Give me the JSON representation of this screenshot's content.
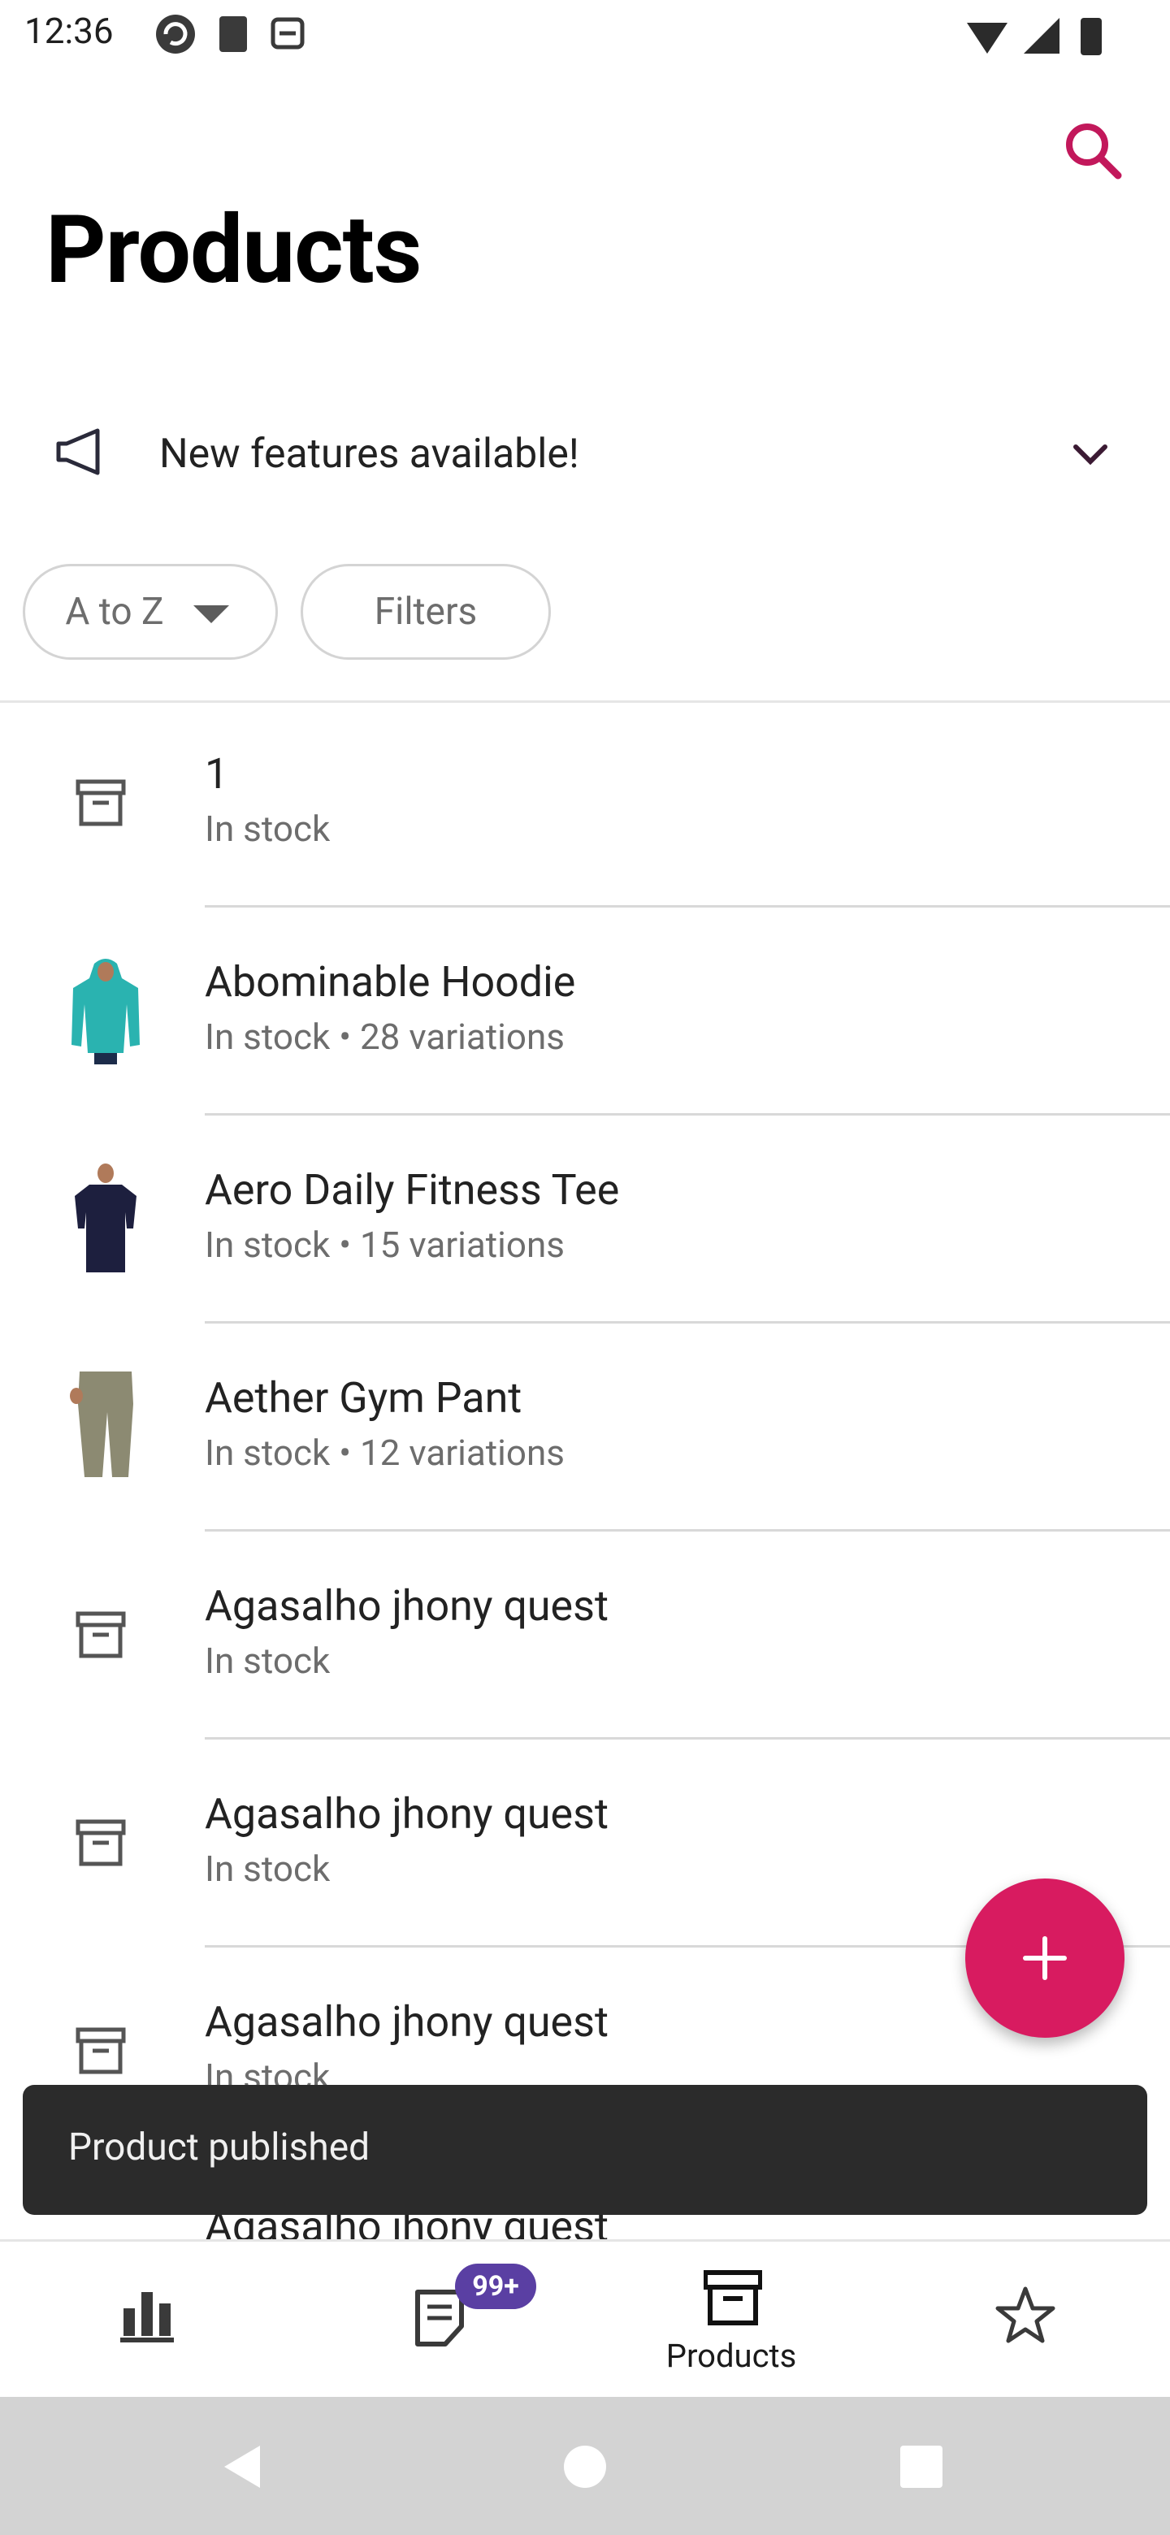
{
  "status_bar": {
    "time": "12:36"
  },
  "header": {
    "title": "Products"
  },
  "banner": {
    "text": "New features available!"
  },
  "filters": {
    "sort_label": "A to Z",
    "filters_label": "Filters"
  },
  "products": [
    {
      "title": "1",
      "subtitle": "In stock",
      "image": "archive-icon"
    },
    {
      "title": "Abominable Hoodie",
      "subtitle": "In stock • 28 variations",
      "image": "hoodie-thumbnail"
    },
    {
      "title": "Aero Daily Fitness Tee",
      "subtitle": "In stock • 15 variations",
      "image": "tee-thumbnail"
    },
    {
      "title": "Aether Gym Pant",
      "subtitle": "In stock • 12 variations",
      "image": "pant-thumbnail"
    },
    {
      "title": "Agasalho jhony quest",
      "subtitle": "In stock",
      "image": "archive-icon"
    },
    {
      "title": "Agasalho jhony quest",
      "subtitle": "In stock",
      "image": "archive-icon"
    },
    {
      "title": "Agasalho jhony quest",
      "subtitle": "In stock",
      "image": "archive-icon"
    },
    {
      "title": "Agasalho jhony quest",
      "subtitle": "",
      "image": "archive-icon"
    }
  ],
  "snackbar": {
    "text": "Product published"
  },
  "bottom_nav": {
    "orders_badge": "99+",
    "products_label": "Products",
    "items": [
      "chart-icon",
      "orders-icon",
      "archive-icon",
      "star-icon"
    ]
  },
  "colors": {
    "accent": "#d81b60",
    "badge": "#5a3fa3",
    "text": "#222222",
    "muted": "#6d6d6d"
  }
}
